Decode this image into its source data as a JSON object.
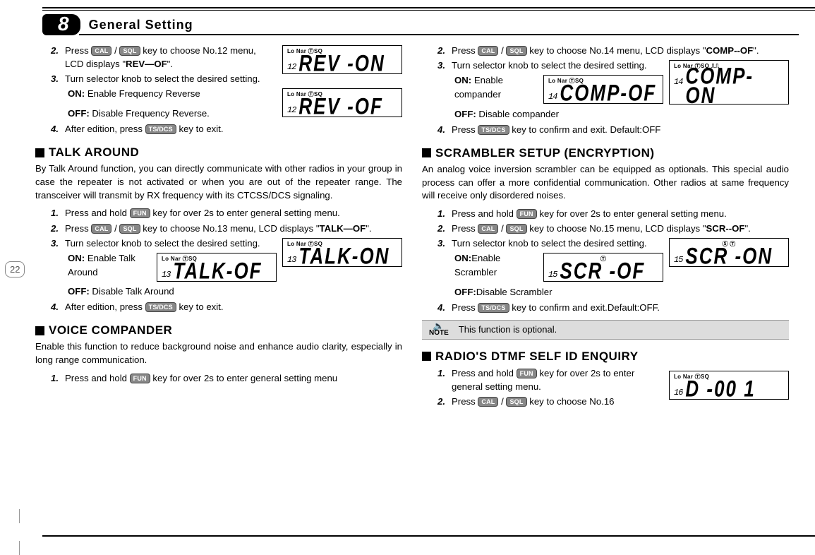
{
  "page_number": "22",
  "chapter_badge": "8",
  "chapter_title": "General Setting",
  "key": {
    "cal": "CAL",
    "sql": "SQL",
    "fun": "FUN",
    "tsdcs": "TS/DCS"
  },
  "rev": {
    "step2a": "Press ",
    "step2b": " key to choose No.12 menu, LCD displays \"",
    "step2c": "REV—OF",
    "step2d": "\".",
    "step3": "Turn selector knob to select the desired setting.",
    "on_l": "ON:",
    "on_t": " Enable Frequency Reverse",
    "off_l": "OFF:",
    "off_t": " Disable Frequency Reverse.",
    "step4a": "After edition, press ",
    "step4b": " key to exit.",
    "lcd_anno": "Lo Nar    ⓉSQ",
    "lcd_on_small": "12",
    "lcd_on_big": "REV -ON",
    "lcd_off_small": "12",
    "lcd_off_big": "REV -OF"
  },
  "talk": {
    "title": "TALK AROUND",
    "desc": "By Talk Around function, you can directly communicate with other radios in your group in case the repeater is not activated or when you are out of the repeater range. The transceiver will transmit by RX frequency with its CTCSS/DCS signaling.",
    "step1a": "Press and hold ",
    "step1b": " key for over 2s to enter general setting menu.",
    "step2a": "Press ",
    "step2b": " key to choose No.13 menu, LCD displays \"",
    "step2c": "TALK—OF",
    "step2d": "\".",
    "step3": "Turn selector knob to select the desired setting.",
    "on_l": "ON:",
    "on_t": " Enable Talk Around",
    "off_l": "OFF:",
    "off_t": " Disable Talk Around",
    "step4a": "After edition, press ",
    "step4b": " key to exit.",
    "lcd_anno": "Lo Nar    ⓉSQ",
    "lcd_on_small": "13",
    "lcd_on_big": "TALK-ON",
    "lcd_off_small": "13",
    "lcd_off_big": "TALK-OF"
  },
  "comp": {
    "title": "VOICE COMPANDER",
    "desc": "Enable this function to reduce background noise and enhance audio clarity, especially in long range communication.",
    "step1a": "Press and hold ",
    "step1b": " key for over 2s to enter general setting  menu",
    "step2a": "Press ",
    "step2b": " key to choose No.14 menu, LCD displays \"",
    "step2c": "COMP--OF",
    "step2d": "\".",
    "step3": "Turn selector knob to select the desired setting.",
    "on_l": "ON:",
    "on_t": " Enable compander",
    "off_l": "OFF:",
    "off_t": " Disable compander",
    "step4a": "Press ",
    "step4b": " key to confirm and exit. Default:OFF",
    "lcd_anno1": "Lo Nar    ⓉSQ    ⎍⎍",
    "lcd_anno2": "Lo Nar    ⓉSQ",
    "lcd_on_small": "14",
    "lcd_on_big": "COMP-ON",
    "lcd_off_small": "14",
    "lcd_off_big": "COMP-OF"
  },
  "scr": {
    "title": "SCRAMBLER SETUP (ENCRYPTION)",
    "desc": "An analog voice inversion scrambler can be equipped as optionals. This special audio process can offer a more confidential communication. Other radios at same frequency will receive only disordered noises.",
    "step1a": "Press and hold ",
    "step1b": " key for over 2s to enter general setting menu.",
    "step2a": "Press ",
    "step2b": " key to choose No.15 menu, LCD displays \"",
    "step2c": "SCR--OF",
    "step2d": "\".",
    "step3": "Turn selector knob to select the desired setting.",
    "on_l": "ON:",
    "on_t": "Enable Scrambler",
    "off_l": "OFF:",
    "off_t": "Disable Scrambler",
    "step4a": "Press ",
    "step4b": " key to confirm and exit.Default:OFF.",
    "note_label": "NOTE",
    "note_text": "This function is optional.",
    "lcd_anno1": "Ⓢ Ⓣ",
    "lcd_anno2": "Ⓣ",
    "lcd_on_small": "15",
    "lcd_on_big": "SCR -ON",
    "lcd_off_small": "15",
    "lcd_off_big": "SCR -OF"
  },
  "dtmf": {
    "title": "RADIO'S DTMF SELF ID ENQUIRY",
    "step1a": " Press and hold ",
    "step1b": " key for over 2s to enter general setting menu.",
    "step2a": "Press ",
    "step2b": " key to choose No.16",
    "lcd_anno": "Lo Nar    ⓉSQ",
    "lcd_small": "16",
    "lcd_big": "D -00 1"
  }
}
